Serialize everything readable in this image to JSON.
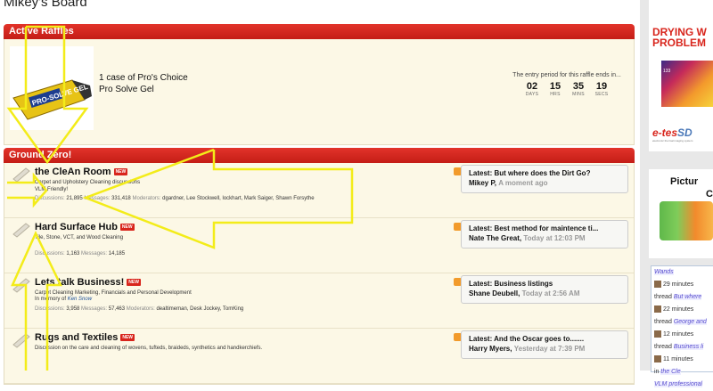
{
  "board_title": "Mikey's Board",
  "raffles": {
    "header": "Active Raffles",
    "item_title_line1": "1 case of Pro's Choice",
    "item_title_line2": "Pro Solve Gel",
    "product_label": "PRO-SOLVE GEL",
    "timer_note": "The entry period for this raffle ends in...",
    "timer": [
      {
        "value": "02",
        "unit": "DAYS"
      },
      {
        "value": "15",
        "unit": "HRS"
      },
      {
        "value": "35",
        "unit": "MINS"
      },
      {
        "value": "19",
        "unit": "SECS"
      }
    ]
  },
  "ground_zero": {
    "header": "Ground Zero!",
    "new_label": "NEW",
    "discussions_label": "Discussions:",
    "messages_label": "Messages:",
    "moderators_label": "Moderators:",
    "forums": [
      {
        "title": "the CleAn Room",
        "desc": "Carpet and Upholstery Cleaning discussions",
        "desc2": "VLM Friendly!",
        "discussions": "21,895",
        "messages": "331,418",
        "moderators": "dgardner, Lee Stockwell, lockhart, Mark Saiger, Shawn Forsythe",
        "last_title": "Latest: But where does the Dirt Go?",
        "last_user": "Mikey P,",
        "last_time": "A moment ago"
      },
      {
        "title": "Hard Surface Hub",
        "desc": "Tile, Stone, VCT, and Wood Cleaning",
        "discussions": "1,163",
        "messages": "14,185",
        "last_title": "Latest: Best method for maintence ti...",
        "last_user": "Nate The Great,",
        "last_time": "Today at 12:03 PM"
      },
      {
        "title": "Lets talk Business!",
        "desc": "Carpet Cleaning Marketing, Financials and Personal Development",
        "memory_prefix": "In memory of",
        "memory_name": "Ken Snow",
        "discussions": "3,958",
        "messages": "57,463",
        "moderators": "dealtimeman, Desk Jockey, TomKing",
        "last_title": "Latest: Business listings",
        "last_user": "Shane Deubell,",
        "last_time": "Today at 2:56 AM"
      },
      {
        "title": "Rugs and Textiles",
        "desc": "Discussion on the care and cleaning of wovens, tufteds, braideds, synthetics and handkerchiefs.",
        "last_title": "Latest: And the Oscar goes to.......",
        "last_user": "Harry Myers,",
        "last_time": "Yesterday at 7:39 PM"
      }
    ]
  },
  "sidebar": {
    "ad1_line1": "DRYING W",
    "ad1_line2": "PROBLEM",
    "thermal_value": "133",
    "etes_brand": "e-tes",
    "etes_sd": "SD",
    "etes_tagline": "electronic thermal imaging system",
    "ad2_line1": "Pictur",
    "ad2_line2": "C",
    "feed": [
      {
        "text": "Wands",
        "type": "tag"
      },
      {
        "text": "29 minutes",
        "type": "time"
      },
      {
        "text": "thread",
        "tag": "But where",
        "type": "thread"
      },
      {
        "text": "22 minutes",
        "type": "time"
      },
      {
        "text": "thread",
        "tag": "George and",
        "type": "thread"
      },
      {
        "text": "12 minutes",
        "type": "time"
      },
      {
        "text": "thread",
        "tag": "Business li",
        "type": "thread"
      },
      {
        "text": "11 minutes",
        "type": "time"
      },
      {
        "text": "in",
        "tag": "the Cle",
        "type": "thread"
      }
    ],
    "feed_footer": "VLM professional"
  },
  "colors": {
    "header_red": "#d8251c",
    "body_cream": "#fcf8e6",
    "overlay_yellow": "#f3ec19"
  }
}
